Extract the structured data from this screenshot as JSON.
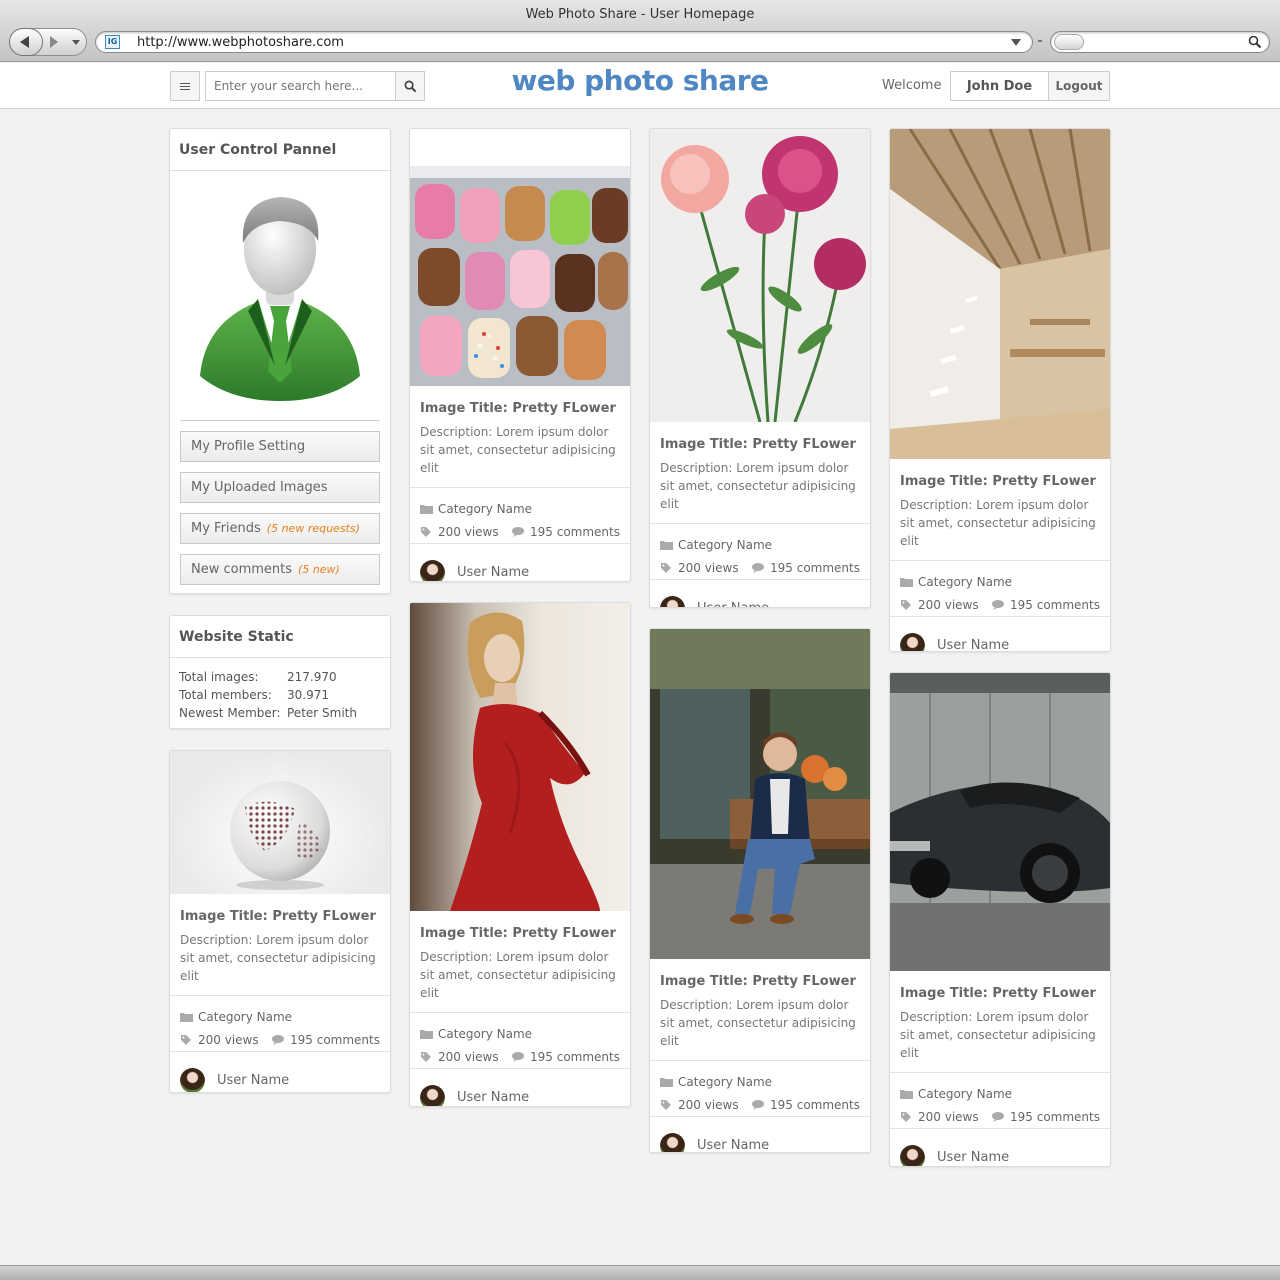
{
  "browser": {
    "window_title": "Web Photo Share - User Homepage",
    "url": "http://www.webphotoshare.com",
    "favicon": "IG"
  },
  "header": {
    "search_placeholder": "Enter your search here...",
    "logo": "web photo share",
    "welcome": "Welcome",
    "username": "John Doe",
    "logout": "Logout"
  },
  "control_panel": {
    "title": "User Control Pannel",
    "items": [
      {
        "label": "My Profile Setting",
        "badge": ""
      },
      {
        "label": "My Uploaded Images",
        "badge": ""
      },
      {
        "label": "My Friends",
        "badge": "(5 new requests)"
      },
      {
        "label": "New comments",
        "badge": "(5 new)"
      }
    ]
  },
  "stats": {
    "title": "Website Static",
    "rows": [
      {
        "label": "Total images:",
        "value": "217.970"
      },
      {
        "label": "Total members:",
        "value": "30.971"
      },
      {
        "label": "Newest Member:",
        "value": "Peter Smith"
      }
    ]
  },
  "post": {
    "title": "Image Title: Pretty FLower",
    "description": "Description: Lorem ipsum dolor sit amet, consectetur adipisicing elit",
    "category": "Category Name",
    "views": "200 views",
    "comments": "195 comments",
    "user": "User Name"
  },
  "colors": {
    "logo": "#4f87c3",
    "badge": "#e8801a",
    "background": "#f2f2f2"
  }
}
